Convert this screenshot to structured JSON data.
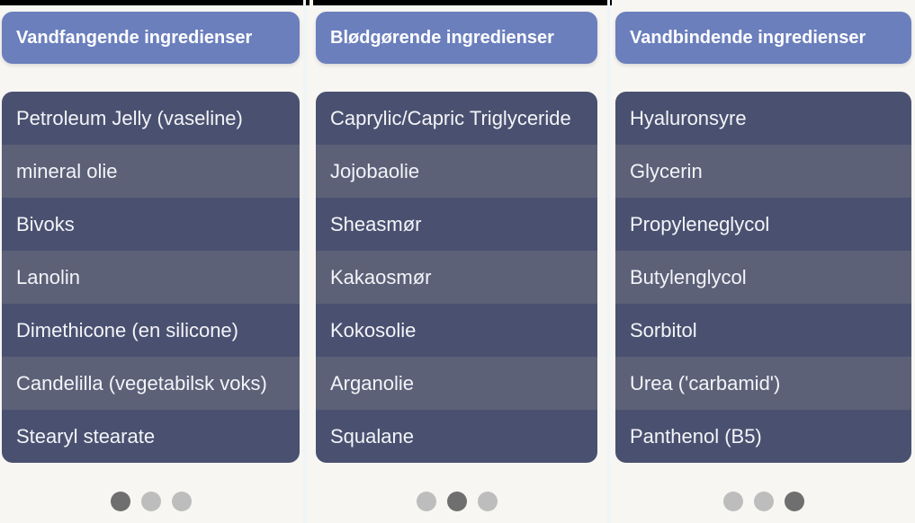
{
  "columns": [
    {
      "title": "Vandfangende ingredienser",
      "items": [
        "Petroleum Jelly (vaseline)",
        "mineral olie",
        "Bivoks",
        "Lanolin",
        "Dimethicone (en silicone)",
        "Candelilla (vegetabilsk voks)",
        "Stearyl stearate"
      ],
      "active_dot": 0
    },
    {
      "title": "Blødgørende ingredienser",
      "items": [
        "Caprylic/Capric Triglyceride",
        "Jojobaolie",
        "Sheasmør",
        "Kakaosmør",
        "Kokosolie",
        "Arganolie",
        "Squalane"
      ],
      "active_dot": 1
    },
    {
      "title": "Vandbindende ingredienser",
      "items": [
        "Hyaluronsyre",
        "Glycerin",
        "Propyleneglycol",
        "Butylenglycol",
        "Sorbitol",
        "Urea ('carbamid')",
        "Panthenol (B5)"
      ],
      "active_dot": 2
    }
  ],
  "colors": {
    "header": "#6b7fbd",
    "row_dark": "#4a5170",
    "row_light": "#5c6178",
    "dot_active": "#6f6f6f",
    "dot_inactive": "#bdbdbd"
  }
}
